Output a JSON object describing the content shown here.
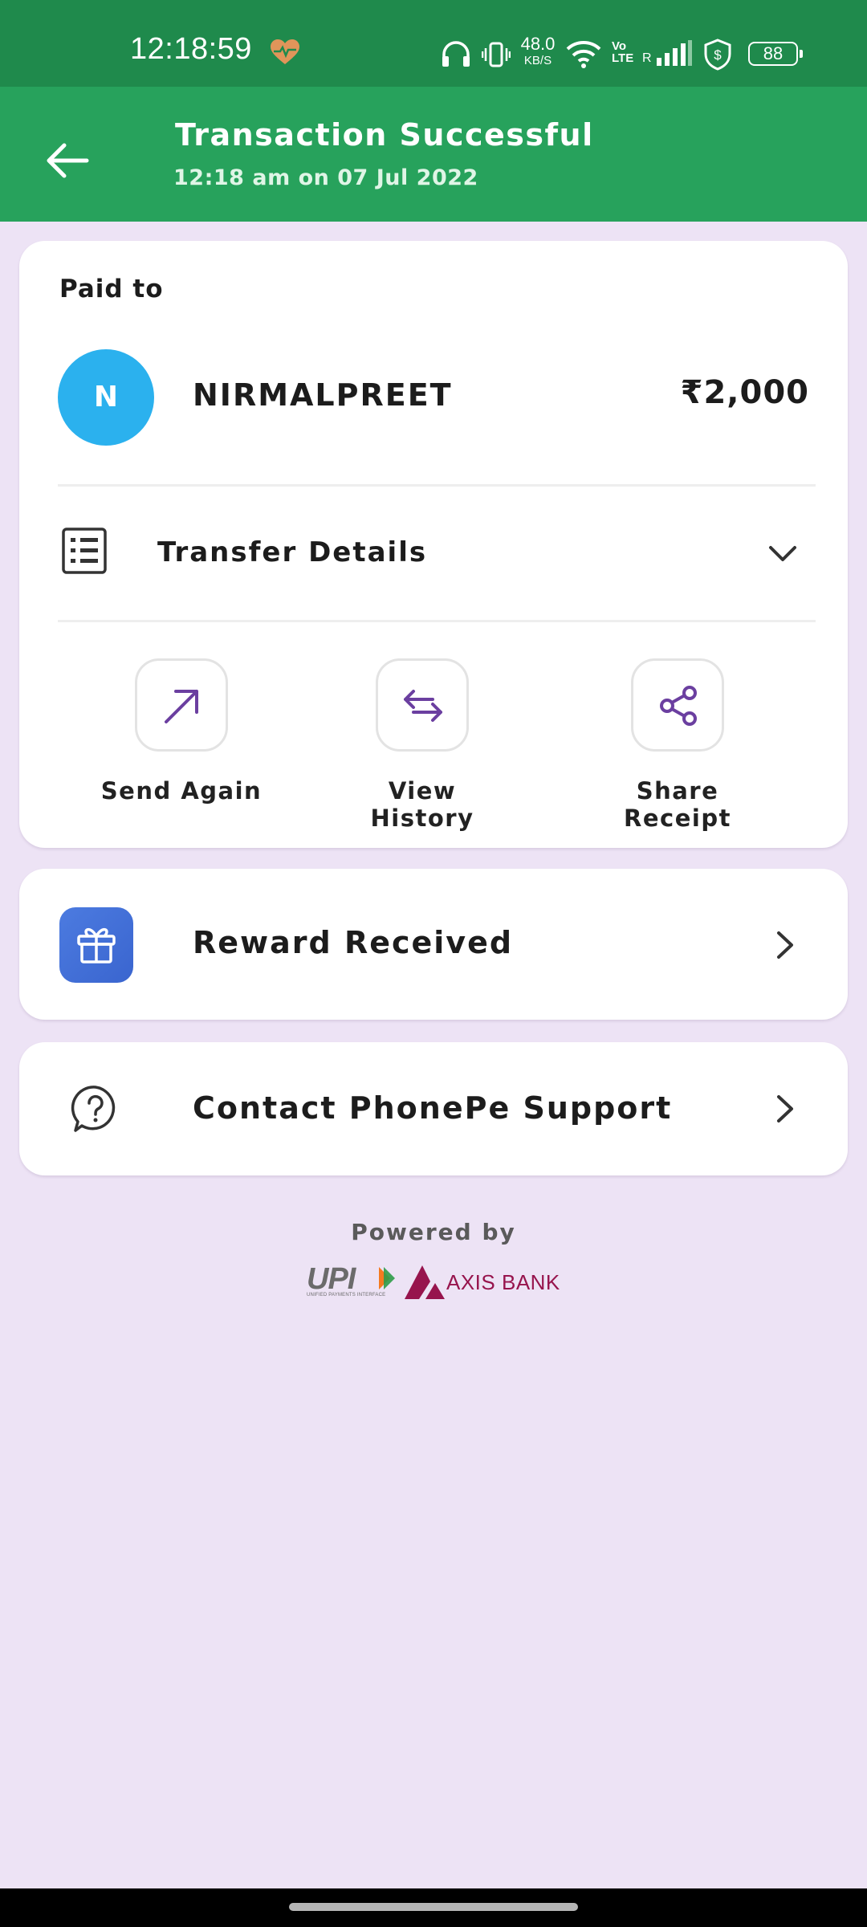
{
  "status_bar": {
    "time": "12:18:59",
    "net_speed_value": "48.0",
    "net_speed_unit": "KB/S",
    "volte_line1": "Vo",
    "volte_line2": "LTE",
    "roaming": "R",
    "battery": "88",
    "icons": [
      "heart-rate-icon",
      "headphones-icon",
      "vibrate-icon",
      "wifi-icon",
      "signal-icon",
      "dollar-shield-icon"
    ]
  },
  "header": {
    "title": "Transaction Successful",
    "subtitle": "12:18 am on 07 Jul 2022",
    "background": "#27a25c"
  },
  "payment": {
    "paid_to_label": "Paid to",
    "avatar_initial": "N",
    "avatar_color": "#2bb1ee",
    "payee_name": "NIRMALPREET",
    "amount": "₹2,000"
  },
  "transfer_details": {
    "label": "Transfer Details"
  },
  "actions": [
    {
      "label": "Send Again",
      "icon": "arrow-up-right-icon"
    },
    {
      "label": "View History",
      "icon": "swap-arrows-icon"
    },
    {
      "label": "Share Receipt",
      "icon": "share-icon"
    }
  ],
  "reward": {
    "label": "Reward Received",
    "icon": "gift-icon"
  },
  "support": {
    "label": "Contact PhonePe Support",
    "icon": "help-circle-icon"
  },
  "footer": {
    "powered_by": "Powered by",
    "upi_text": "UPI",
    "upi_subtext": "UNIFIED PAYMENTS INTERFACE",
    "bank_name": "AXIS BANK"
  },
  "colors": {
    "accent_purple": "#6b3fa0",
    "page_background": "#ede3f5",
    "status_bar": "#1f8a4c"
  }
}
